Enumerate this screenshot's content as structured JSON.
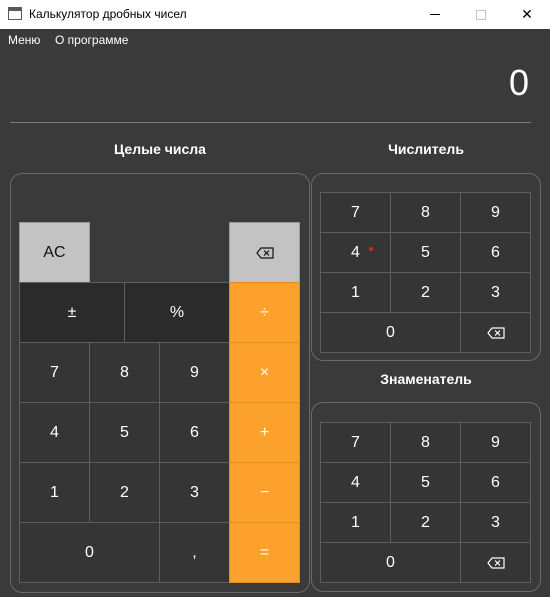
{
  "window": {
    "title": "Калькулятор дробных чисел",
    "close_glyph": "✕"
  },
  "menu": {
    "items": [
      "Меню",
      "О программе"
    ]
  },
  "display": {
    "value": "0"
  },
  "sections": {
    "integers_title": "Целые числа",
    "numerator_title": "Числитель",
    "denominator_title": "Знаменатель"
  },
  "integer_keys": {
    "ac": "AC",
    "plus_minus": "±",
    "percent": "%",
    "divide": "÷",
    "multiply": "×",
    "add": "+",
    "subtract": "−",
    "equals": "=",
    "comma": ",",
    "digits": [
      "0",
      "1",
      "2",
      "3",
      "4",
      "5",
      "6",
      "7",
      "8",
      "9"
    ]
  },
  "numerator_keys": {
    "digits": [
      "0",
      "1",
      "2",
      "3",
      "4",
      "5",
      "6",
      "7",
      "8",
      "9"
    ],
    "backspace_icon": "backspace-icon"
  },
  "denominator_keys": {
    "digits": [
      "0",
      "1",
      "2",
      "3",
      "4",
      "5",
      "6",
      "7",
      "8",
      "9"
    ],
    "backspace_icon": "backspace-icon"
  },
  "colors": {
    "background": "#3a3a3a",
    "operator": "#fca22c",
    "gray_key": "#c3c3c3",
    "focus_dot": "#e02020"
  }
}
